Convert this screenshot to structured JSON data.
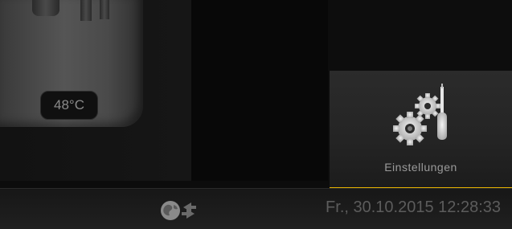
{
  "boiler": {
    "temperature": "48°C"
  },
  "settings": {
    "label": "Einstellungen",
    "icon": "gears-screwdriver-icon"
  },
  "status_bar": {
    "datetime": "Fr., 30.10.2015 12:28:33",
    "icon": "globe-sync-icon"
  },
  "colors": {
    "accent": "#e5b200",
    "background": "#0c0c0c",
    "tile": "#2b2b2b"
  }
}
